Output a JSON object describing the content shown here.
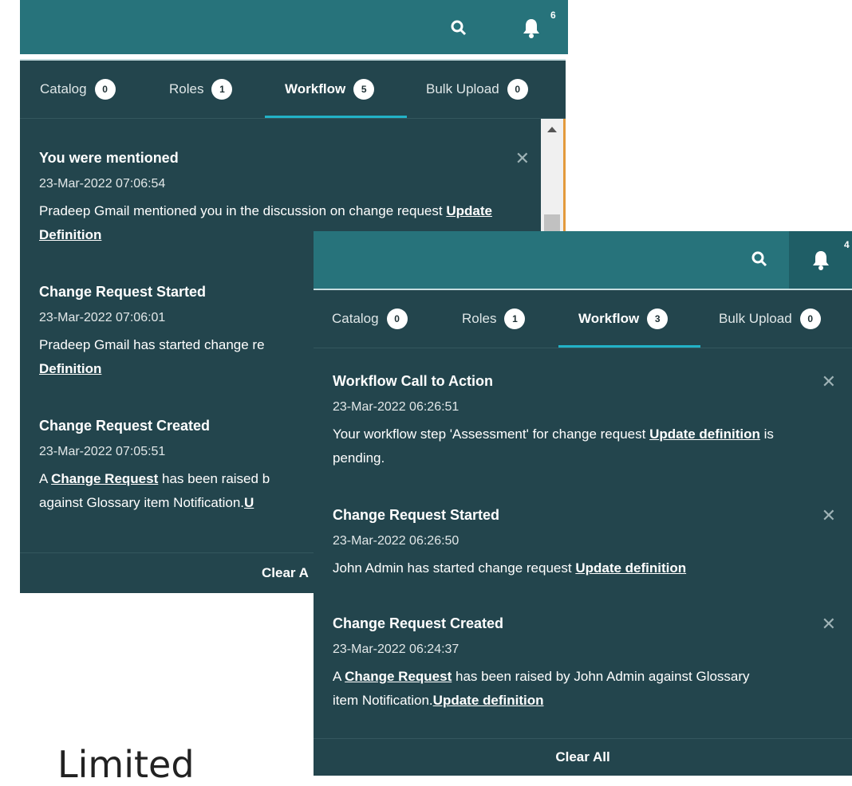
{
  "back_panel": {
    "search_icon": "search-icon",
    "bell_icon": "bell-icon",
    "bell_count": "6",
    "tabs": [
      {
        "label": "Catalog",
        "count": "0"
      },
      {
        "label": "Roles",
        "count": "1"
      },
      {
        "label": "Workflow",
        "count": "5"
      },
      {
        "label": "Bulk Upload",
        "count": "0"
      }
    ],
    "notifications": [
      {
        "title": "You were mentioned",
        "time": "23-Mar-2022 07:06:54",
        "text_before": "Pradeep Gmail mentioned you in the discussion on change request ",
        "link": "Update Definition"
      },
      {
        "title": "Change Request Started",
        "time": "23-Mar-2022 07:06:01",
        "text_before": "Pradeep Gmail has started change re",
        "link": "Definition"
      },
      {
        "title": "Change Request Created",
        "time": "23-Mar-2022 07:05:51",
        "text_a": "A ",
        "link1": "Change Request",
        "text_b": " has been raised b",
        "text_c": "against Glossary item Notification.",
        "link2": "U"
      }
    ],
    "clear_all": "Clear A"
  },
  "front_panel": {
    "search_icon": "search-icon",
    "bell_icon": "bell-icon",
    "bell_count": "4",
    "tabs": [
      {
        "label": "Catalog",
        "count": "0"
      },
      {
        "label": "Roles",
        "count": "1"
      },
      {
        "label": "Workflow",
        "count": "3"
      },
      {
        "label": "Bulk Upload",
        "count": "0"
      }
    ],
    "notifications": [
      {
        "title": "Workflow Call to Action",
        "time": "23-Mar-2022 06:26:51",
        "text_before": "Your workflow step 'Assessment' for change request ",
        "link": "Update definition",
        "text_after": " is pending."
      },
      {
        "title": "Change Request Started",
        "time": "23-Mar-2022 06:26:50",
        "text_before": "John Admin has started change request ",
        "link": "Update definition"
      },
      {
        "title": "Change Request Created",
        "time": "23-Mar-2022 06:24:37",
        "text_a": "A ",
        "link1": "Change Request",
        "text_b": " has been raised by John Admin against Glossary item Notification.",
        "link2": "Update definition"
      }
    ],
    "clear_all": "Clear All"
  },
  "background_text": "Limited",
  "colors": {
    "header": "#27737b",
    "panel": "#23454d",
    "accent": "#22b2c7"
  }
}
